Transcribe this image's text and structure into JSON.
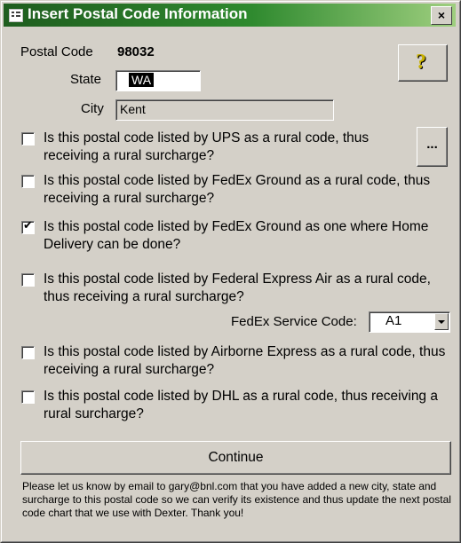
{
  "window": {
    "title": "Insert Postal Code Information",
    "close_label": "×",
    "title_gradient": [
      "#1f5d1f",
      "#9fcf7f"
    ],
    "face_color": "#d4d0c8"
  },
  "fields": {
    "postal_code_label": "Postal Code",
    "postal_code_value": "98032",
    "state_label": "State",
    "state_value": "WA",
    "city_label": "City",
    "city_value": "Kent"
  },
  "buttons": {
    "help_icon": "help-key-icon",
    "help_glyph": "?",
    "more_label": "...",
    "continue_label": "Continue"
  },
  "questions": [
    {
      "text": "Is this postal code listed by UPS as a rural code, thus receiving a rural surcharge?",
      "checked": false
    },
    {
      "text": "Is this postal code listed by FedEx Ground as a rural code, thus receiving a rural surcharge?",
      "checked": false
    },
    {
      "text": "Is this postal code listed by FedEx Ground as one where Home Delivery can be done?",
      "checked": true
    },
    {
      "text": "Is this postal code listed by Federal Express Air as a rural code, thus receiving a rural surcharge?",
      "checked": false
    },
    {
      "text": "Is this postal code listed by Airborne Express as a rural code, thus receiving a rural surcharge?",
      "checked": false
    },
    {
      "text": "Is this postal code listed by DHL as a rural code, thus receiving a rural surcharge?",
      "checked": false
    }
  ],
  "checkmark": "✔",
  "fedex_service": {
    "label": "FedEx Service Code:",
    "value": "A1"
  },
  "footer_note": "Please let us know by email to gary@bnl.com that you have added a new city, state and surcharge to this postal code so we can verify its existence and thus update the next postal code chart that we use with Dexter. Thank you!"
}
